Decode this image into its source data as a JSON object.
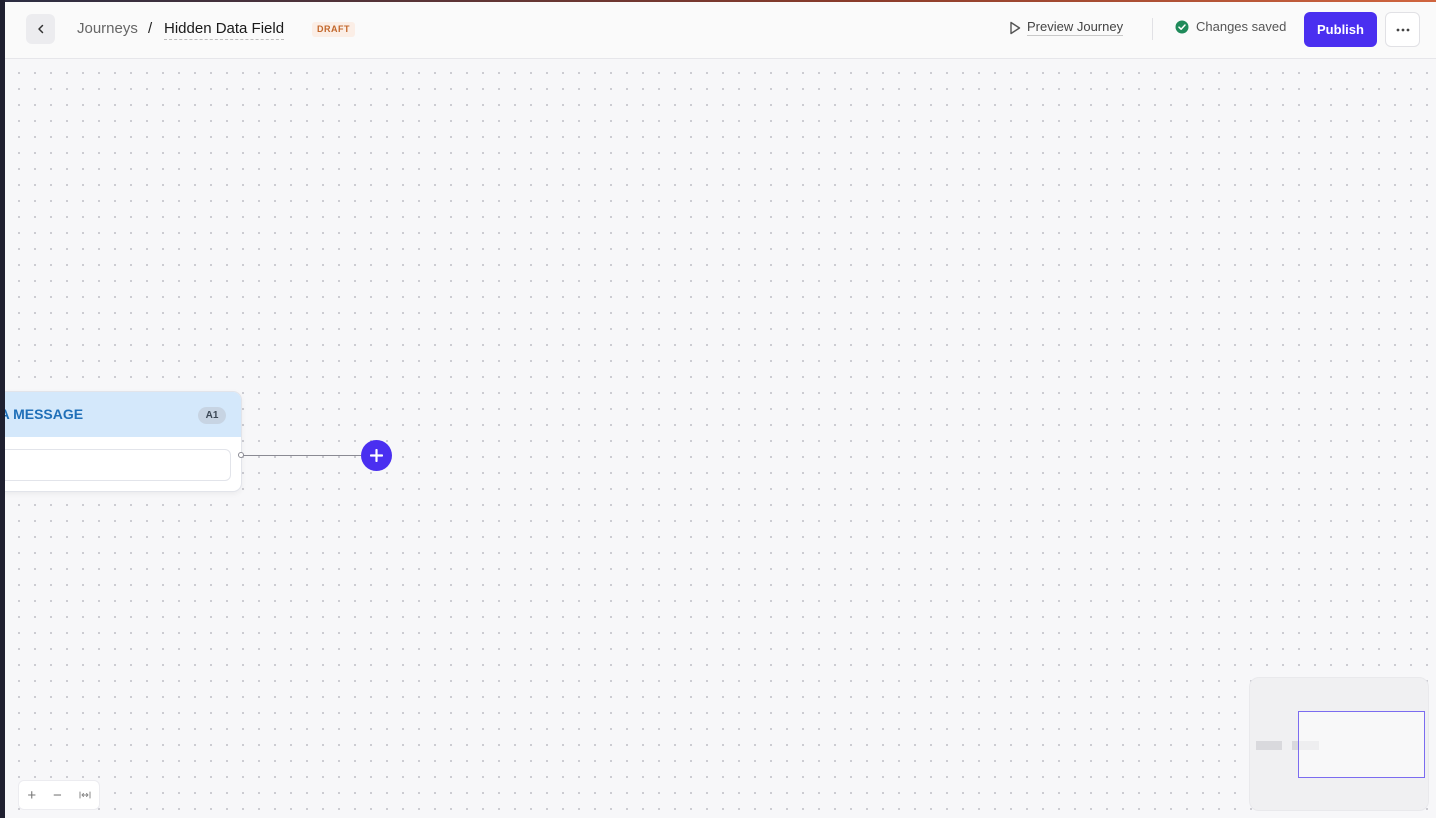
{
  "header": {
    "breadcrumb_root": "Journeys",
    "breadcrumb_separator": "/",
    "journey_name": "Hidden Data Field",
    "status_badge": "DRAFT",
    "preview_label": "Preview Journey",
    "saved_status": "Changes saved",
    "publish_label": "Publish",
    "more_icon": "ellipsis-icon",
    "back_icon": "chevron-left-icon"
  },
  "canvas": {
    "node": {
      "title": "SEND A MESSAGE",
      "visible_title": "ND A MESSAGE",
      "tag": "A1"
    },
    "add_step_icon": "plus-icon"
  },
  "zoom_controls": {
    "zoom_in": "+",
    "zoom_out": "−",
    "fit_icon": "fit-width-icon"
  },
  "colors": {
    "accent": "#4a2ff0",
    "node_header": "#d4e8fb",
    "node_title": "#1f6fb8",
    "draft_badge_bg": "#fbeee6",
    "draft_badge_text": "#c2672b",
    "saved_check": "#1f8a5a"
  }
}
